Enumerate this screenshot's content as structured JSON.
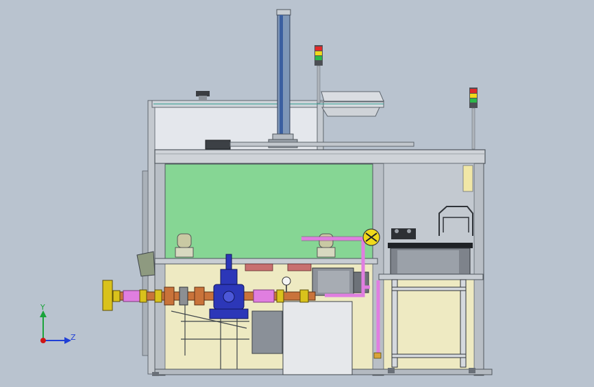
{
  "triad": {
    "y_label": "Y",
    "z_label": "Z",
    "y_color": "#1aa33a",
    "z_color": "#1f3fd6",
    "origin_color": "#d01515"
  },
  "colors": {
    "background": "#b9c3cf",
    "frame": "#b8bec6",
    "frame_dark": "#6f7780",
    "panel_green": "#86d694",
    "panel_light": "#e4e7ec",
    "valve_blue": "#2c37b8",
    "pipe_pink": "#e07ee0",
    "pipe_orange": "#c9733a",
    "flange_yellow": "#d9c21c",
    "base_yellow": "#eeeac2",
    "tank": "#7d828a"
  },
  "signal_towers": [
    {
      "name": "left-tower",
      "lights": [
        "#e02a2a",
        "#f0d91c",
        "#2db84a"
      ]
    },
    {
      "name": "right-tower",
      "lights": [
        "#e02a2a",
        "#f0d91c",
        "#2db84a"
      ]
    }
  ]
}
